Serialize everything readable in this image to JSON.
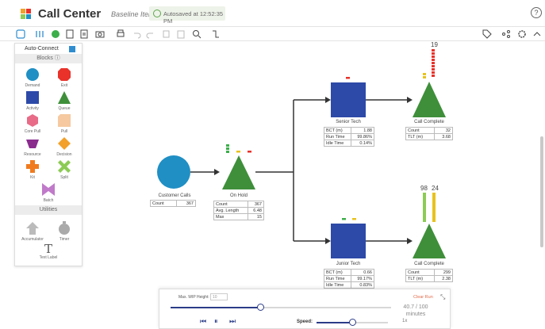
{
  "app": {
    "title": "Call Center",
    "subtitle": "Baseline Iteration",
    "autosave": "Autosaved at 12:52:35 PM"
  },
  "toolbar": {
    "icons": [
      "select-icon",
      "layout-icon",
      "refresh-icon",
      "export-icon",
      "report-icon",
      "camera-icon",
      "print-icon",
      "undo-icon",
      "redo-icon",
      "copy-icon",
      "paste-icon",
      "zoom-icon",
      "connector-icon",
      "tag-icon",
      "share-icon",
      "settings-icon",
      "collapse-icon"
    ]
  },
  "palette": {
    "auto_connect": "Auto-Connect",
    "blocks_header": "Blocks",
    "blocks": [
      {
        "label": "Demand",
        "icon": "circle-icon",
        "color": "#1f8fc4"
      },
      {
        "label": "Exit",
        "icon": "octagon-icon",
        "color": "#e8322a"
      },
      {
        "label": "Activity",
        "icon": "square-icon",
        "color": "#2d4aa8"
      },
      {
        "label": "Queue",
        "icon": "triangle-icon",
        "color": "#3f8f3a"
      },
      {
        "label": "Core Pull",
        "icon": "hexagon-icon",
        "color": "#e86b87"
      },
      {
        "label": "Pull",
        "icon": "pull-icon",
        "color": "#f6c9a0"
      },
      {
        "label": "Resource",
        "icon": "trapezoid-icon",
        "color": "#8a2b8e"
      },
      {
        "label": "Decision",
        "icon": "diamond-icon",
        "color": "#f2a02a"
      },
      {
        "label": "Kit",
        "icon": "plus-icon",
        "color": "#f07b1f"
      },
      {
        "label": "Split",
        "icon": "split-icon",
        "color": "#8ccb55"
      },
      {
        "label": "Batch",
        "icon": "bowtie-icon",
        "color": "#c07ac9"
      }
    ],
    "utilities_header": "Utilities",
    "utilities": [
      {
        "label": "Accumulator",
        "icon": "accumulator-icon"
      },
      {
        "label": "Timer",
        "icon": "timer-icon"
      },
      {
        "label": "Text Label",
        "icon": "text-icon",
        "glyph": "T"
      }
    ]
  },
  "nodes": {
    "customer_calls": {
      "label": "Customer Calls",
      "stats": [
        [
          "Count",
          "367"
        ]
      ]
    },
    "on_hold": {
      "label": "On Hold",
      "stats": [
        [
          "Count",
          "367"
        ],
        [
          "Avg. Length",
          "6.48"
        ],
        [
          "Max",
          "15"
        ]
      ]
    },
    "senior_tech": {
      "label": "Senior Tech",
      "stats": [
        [
          "BCT (m)",
          "1.88"
        ],
        [
          "Run Time",
          "99.86%"
        ],
        [
          "Idle Time",
          "0.14%"
        ]
      ]
    },
    "junior_tech": {
      "label": "Junior Tech",
      "stats": [
        [
          "BCT (m)",
          "0.66"
        ],
        [
          "Run Time",
          "99.17%"
        ],
        [
          "Idle Time",
          "0.83%"
        ]
      ]
    },
    "call_complete_top": {
      "label": "Call Complete",
      "count_top": "19",
      "stats": [
        [
          "Count",
          "32"
        ],
        [
          "TLT (m)",
          "3.68"
        ]
      ]
    },
    "call_complete_bottom": {
      "label": "Call Complete",
      "count_top_a": "98",
      "count_top_b": "24",
      "stats": [
        [
          "Count",
          "299"
        ],
        [
          "TLT (m)",
          "2.38"
        ]
      ]
    }
  },
  "player": {
    "wip_label": "Max. WIP Height:",
    "wip_value": "10",
    "clear_run": "Clear Run",
    "progress": 0.407,
    "time_line1": "40.7 / 100",
    "time_line2": "minutes",
    "speed_label": "Speed:",
    "speed_value": "1x",
    "speed_fraction": 0.5
  }
}
